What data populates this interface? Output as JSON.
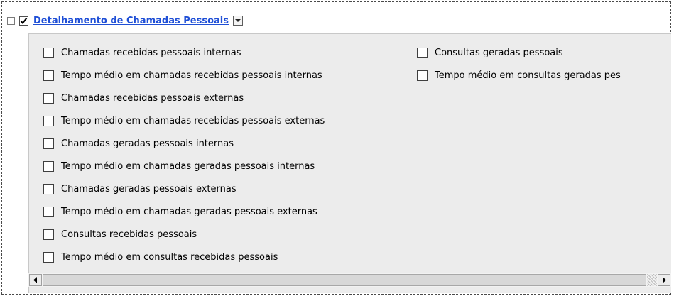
{
  "section": {
    "title": "Detalhamento de Chamadas Pessoais",
    "checked": true,
    "expanded": true
  },
  "options_col1": [
    {
      "label": "Chamadas recebidas pessoais internas",
      "checked": false
    },
    {
      "label": "Tempo médio em chamadas recebidas pessoais internas",
      "checked": false
    },
    {
      "label": "Chamadas recebidas pessoais externas",
      "checked": false
    },
    {
      "label": "Tempo médio em chamadas recebidas pessoais externas",
      "checked": false
    },
    {
      "label": "Chamadas geradas pessoais internas",
      "checked": false
    },
    {
      "label": "Tempo médio em chamadas geradas pessoais internas",
      "checked": false
    },
    {
      "label": "Chamadas geradas pessoais externas",
      "checked": false
    },
    {
      "label": "Tempo médio em chamadas geradas pessoais externas",
      "checked": false
    },
    {
      "label": "Consultas recebidas pessoais",
      "checked": false
    },
    {
      "label": "Tempo médio em consultas recebidas pessoais",
      "checked": false
    }
  ],
  "options_col2": [
    {
      "label": "Consultas geradas pessoais",
      "checked": false
    },
    {
      "label": "Tempo médio em consultas geradas pes",
      "checked": false
    }
  ],
  "icons": {
    "collapse": "minus-box-icon",
    "check": "checkmark-icon",
    "dropdown": "chevron-down-icon",
    "scroll_left": "arrow-left-icon",
    "scroll_right": "arrow-right-icon"
  },
  "colors": {
    "link": "#1f4fd6",
    "panel_bg": "#ececec"
  }
}
